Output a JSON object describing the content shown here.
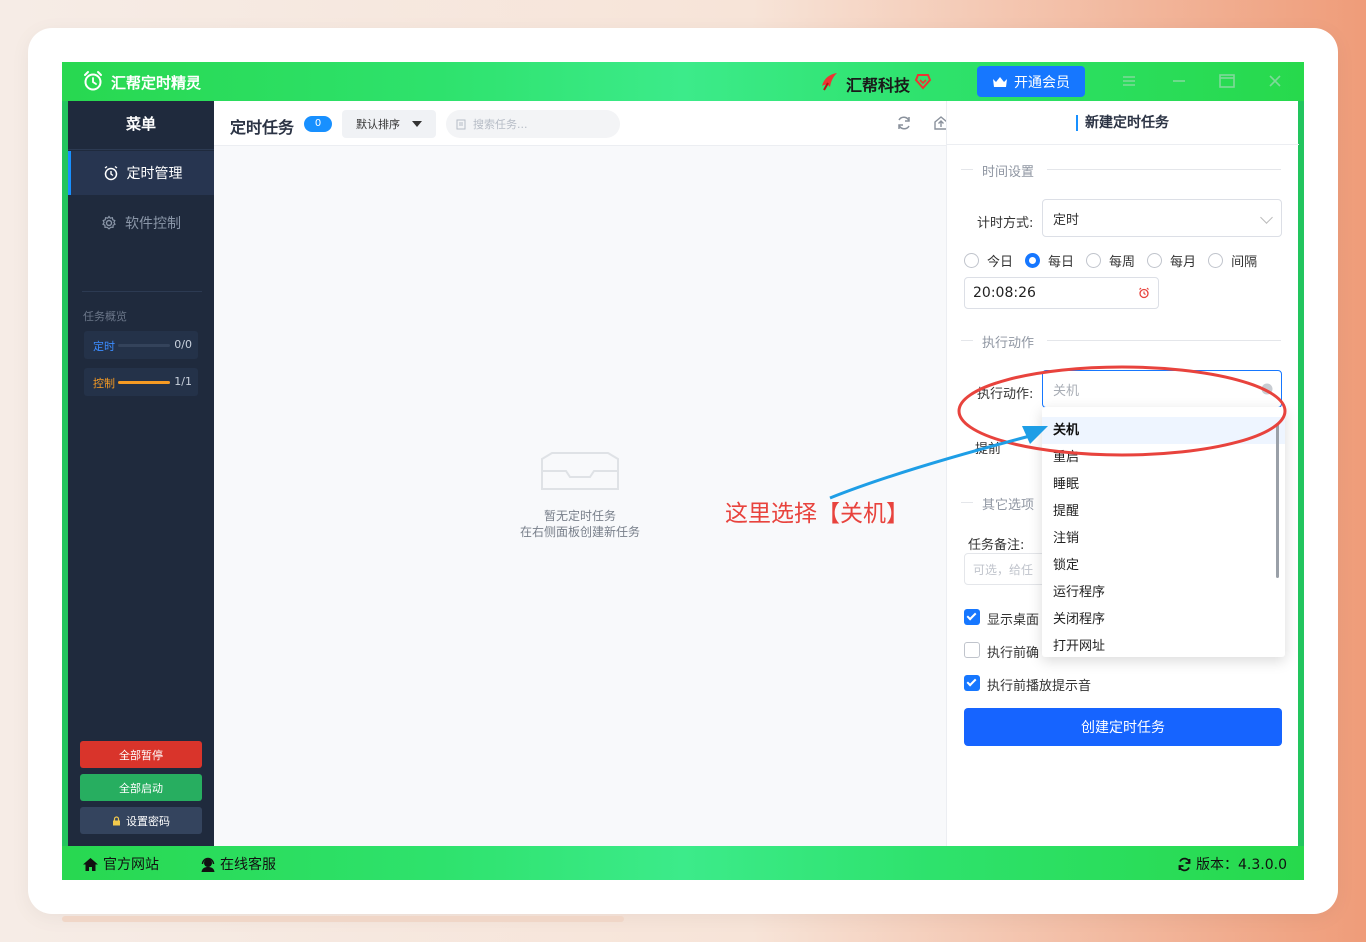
{
  "titlebar": {
    "app_name": "汇帮定时精灵",
    "brand": "汇帮科技",
    "vip_button": "开通会员"
  },
  "sidebar": {
    "title": "菜单",
    "items": [
      {
        "label": "定时管理",
        "active": true
      },
      {
        "label": "软件控制",
        "active": false
      }
    ],
    "overview_title": "任务概览",
    "stats": [
      {
        "label": "定时",
        "value": "0/0",
        "progress": 0
      },
      {
        "label": "控制",
        "value": "1/1",
        "progress": 1
      }
    ],
    "buttons": {
      "pause_all": "全部暂停",
      "start_all": "全部启动",
      "set_password": "设置密码"
    }
  },
  "main": {
    "title": "定时任务",
    "count": "0",
    "sort": "默认排序",
    "search_placeholder": "搜索任务...",
    "empty_line1": "暂无定时任务",
    "empty_line2": "在右侧面板创建新任务"
  },
  "panel": {
    "title": "新建定时任务",
    "section_time": "时间设置",
    "timing_mode_label": "计时方式:",
    "timing_mode_value": "定时",
    "frequency_options": [
      "今日",
      "每日",
      "每周",
      "每月",
      "间隔"
    ],
    "frequency_selected": "每日",
    "time_value": "20:08:26",
    "section_action": "执行动作",
    "action_label": "执行动作:",
    "action_value": "关机",
    "advance_label": "提前",
    "section_other": "其它选项",
    "remark_label": "任务备注:",
    "remark_placeholder": "可选，给任",
    "checkboxes": [
      {
        "label": "显示桌面",
        "checked": true
      },
      {
        "label": "执行前确",
        "checked": false
      },
      {
        "label": "执行前播放提示音",
        "checked": true
      }
    ],
    "create_button": "创建定时任务"
  },
  "dropdown": {
    "options": [
      "关机",
      "重启",
      "睡眠",
      "提醒",
      "注销",
      "锁定",
      "运行程序",
      "关闭程序",
      "打开网址"
    ],
    "selected": "关机"
  },
  "annotation": {
    "text": "这里选择【关机】",
    "color": "#e8433d"
  },
  "bottombar": {
    "website": "官方网站",
    "support": "在线客服",
    "version": "版本：4.3.0.0"
  },
  "colors": {
    "titlebar": "#2ee26c",
    "sidebar": "#1f2a3d",
    "primary": "#1677ff"
  }
}
